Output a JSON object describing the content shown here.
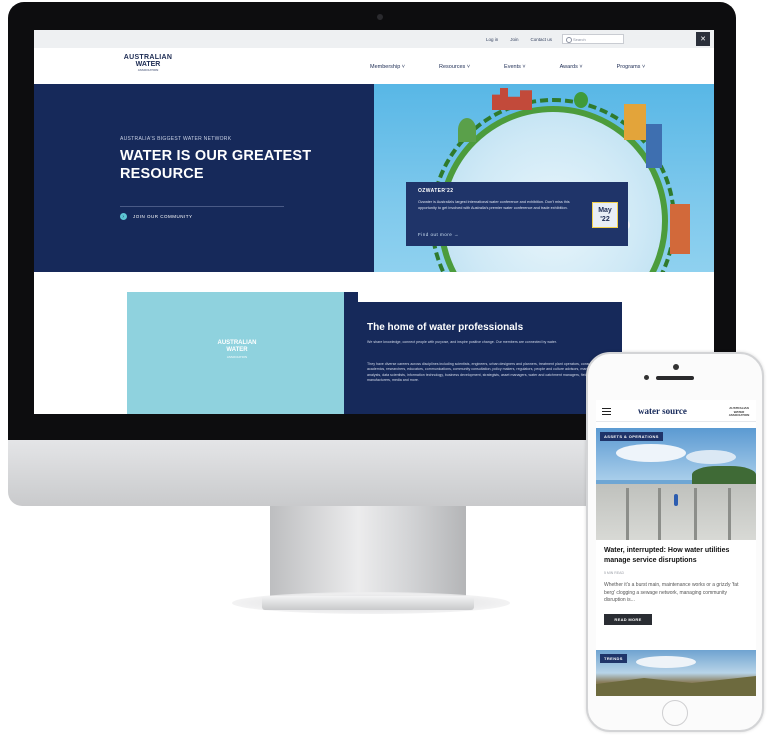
{
  "desktop": {
    "utility_links": [
      "Log in",
      "Join",
      "Contact us"
    ],
    "search_placeholder": "Search",
    "logo": {
      "line1": "AUSTRALIAN",
      "line2": "WATER",
      "line3": "ASSOCIATION"
    },
    "nav": [
      "Membership ˅",
      "Resources ˅",
      "Events ˅",
      "Awards ˅",
      "Programs ˅"
    ],
    "hero": {
      "kicker": "AUSTRALIA'S BIGGEST WATER NETWORK",
      "title": "WATER IS OUR GREATEST RESOURCE",
      "cta": "JOIN OUR COMMUNITY"
    },
    "event_card": {
      "title": "OZWATER'22",
      "text": "Ozwater is Australia's largest international water conference and exhibition. Don't miss this opportunity to get involved with Australia's premier water conference and trade exhibition.",
      "link": "Find out more →",
      "date_line1": "May",
      "date_line2": "'22"
    },
    "about": {
      "logo_line1": "AUSTRALIAN",
      "logo_line2": "WATER",
      "logo_line3": "ASSOCIATION",
      "title": "The home of water professionals",
      "p1": "We share knowledge, connect people with purpose, and inspire positive change. Our members are connected by water.",
      "p2": "They have diverse careers across disciplines including scientists, engineers, urban designers and planners, treatment plant operators, consultants, academics, researchers, educators, communications, community consultation, policy makers, regulators, people and culture advisors, managers, data analysts, data scientists, information technology, business development, strategists, asset managers, water and catchment managers, field workers, manufacturers, media and more."
    }
  },
  "mobile": {
    "logo": "water source",
    "mini_logo": "AUSTRALIAN WATER ASSOCIATION",
    "tag1": "ASSETS & OPERATIONS",
    "article": {
      "title": "Water, interrupted: How water utilities manage service disruptions",
      "meta": "5 MIN READ",
      "excerpt": "Whether it's a burst main, maintenance works or a grizzly 'fat berg' clogging a sewage network, managing community disruption is...",
      "read_more": "READ MORE"
    },
    "tag2": "TRENDS"
  }
}
